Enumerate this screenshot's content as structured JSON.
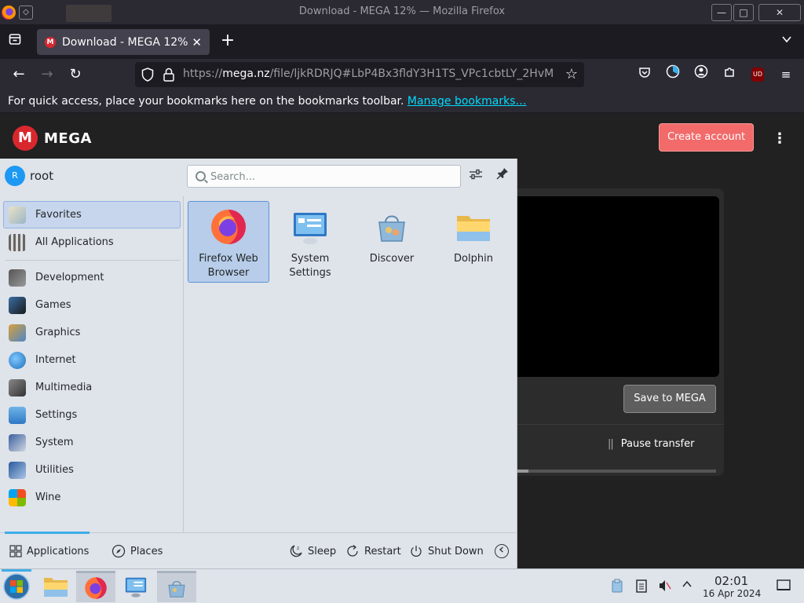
{
  "window": {
    "title": "Download - MEGA 12% — Mozilla Firefox",
    "close_glyph": "✕",
    "max_glyph": "□",
    "min_glyph": "—"
  },
  "tabs": [
    {
      "title": "Download - MEGA 12%",
      "close": "✕"
    }
  ],
  "toolbar": {
    "new_tab": "+",
    "back": "←",
    "forward": "→",
    "reload": "↻",
    "overflow": "⌄",
    "star": "☆",
    "menu": "≡"
  },
  "url": {
    "scheme": "https://",
    "domain": "mega.nz",
    "path": "/file/ljkRDRJQ#LbP4Bx3fldY3H1TS_VPc1cbtLY_2HvM"
  },
  "bookmarks_bar": {
    "text": "For quick access, place your bookmarks here on the bookmarks toolbar.",
    "link": "Manage bookmarks…"
  },
  "mega": {
    "logo_letter": "M",
    "logo_word": "MEGA",
    "create_account": "Create account",
    "menu": "⋮",
    "save_button": "Save to MEGA",
    "pause_icon": "||",
    "pause_label": "Pause transfer",
    "progress": 0.12,
    "brand_color": "#d9272e",
    "accent_color": "#f26a6a"
  },
  "launcher": {
    "user_initial": "R",
    "user_name": "root",
    "search_placeholder": "Search...",
    "sidebar": [
      {
        "label": "Favorites",
        "icon": "favorites-icon",
        "active": true
      },
      {
        "label": "All Applications",
        "icon": "all-applications-icon",
        "active": false
      },
      {
        "label": "Development",
        "icon": "development-icon",
        "active": false
      },
      {
        "label": "Games",
        "icon": "games-icon",
        "active": false
      },
      {
        "label": "Graphics",
        "icon": "graphics-icon",
        "active": false
      },
      {
        "label": "Internet",
        "icon": "internet-icon",
        "active": false
      },
      {
        "label": "Multimedia",
        "icon": "multimedia-icon",
        "active": false
      },
      {
        "label": "Settings",
        "icon": "settings-icon",
        "active": false
      },
      {
        "label": "System",
        "icon": "system-icon",
        "active": false
      },
      {
        "label": "Utilities",
        "icon": "utilities-icon",
        "active": false
      },
      {
        "label": "Wine",
        "icon": "wine-icon",
        "active": false
      }
    ],
    "favorites": [
      {
        "line1": "Firefox Web",
        "line2": "Browser",
        "icon": "firefox-icon",
        "active": true
      },
      {
        "line1": "System",
        "line2": "Settings",
        "icon": "system-settings-icon",
        "active": false
      },
      {
        "line1": "Discover",
        "line2": "",
        "icon": "discover-icon",
        "active": false
      },
      {
        "line1": "Dolphin",
        "line2": "",
        "icon": "dolphin-icon",
        "active": false
      }
    ],
    "footer": {
      "applications": "Applications",
      "places": "Places",
      "sleep": "Sleep",
      "restart": "Restart",
      "shutdown": "Shut Down"
    }
  },
  "taskbar": {
    "time": "02:01",
    "date": "16 Apr 2024"
  }
}
